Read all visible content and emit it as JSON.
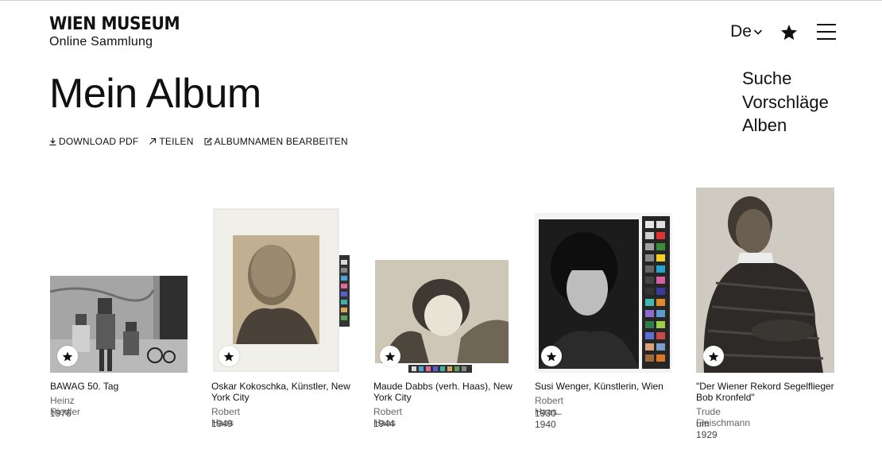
{
  "header": {
    "logo_title": "WIEN MUSEUM",
    "logo_subtitle": "Online Sammlung",
    "language": "De",
    "icons": {
      "language_chevron": "chevron-down-icon",
      "favorites": "star-icon",
      "menu": "hamburger-menu-icon"
    }
  },
  "nav": {
    "items": [
      "Suche",
      "Vorschläge",
      "Alben"
    ]
  },
  "page": {
    "title": "Mein Album"
  },
  "actions": {
    "download": "DOWNLOAD PDF",
    "share": "TEILEN",
    "edit": "ALBUMNAMEN BEARBEITEN"
  },
  "cards": [
    {
      "title": "BAWAG 50. Tag",
      "author": "Heinz Riedler",
      "year": "1976"
    },
    {
      "title": "Oskar Kokoschka, Künstler, New York City",
      "author": "Robert Haas",
      "year": "1949"
    },
    {
      "title": "Maude Dabbs (verh. Haas), New York City",
      "author": "Robert Haas",
      "year": "1944"
    },
    {
      "title": "Susi Wenger, Künstlerin, Wien",
      "author": "Robert Haas",
      "year": "1930–1940"
    },
    {
      "title": "\"Der Wiener Rekord Segelflieger Bob Kronfeld\"",
      "author": "Trude Fleischmann",
      "year": "um 1929"
    }
  ],
  "colors": {
    "text": "#111111",
    "muted": "#666666",
    "background": "#ffffff"
  }
}
